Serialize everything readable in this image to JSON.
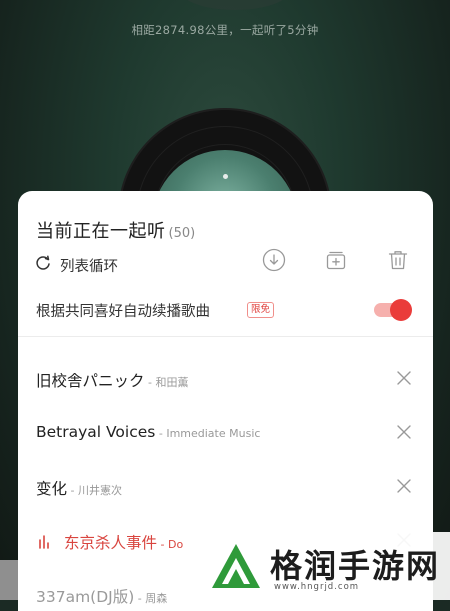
{
  "background": {
    "distance_text": "相距2874.98公里，一起听了5分钟"
  },
  "panel": {
    "title": "当前正在一起听",
    "count": "(50)",
    "play_mode_label": "列表循环",
    "actions": [
      {
        "icon": "download-icon"
      },
      {
        "icon": "add-to-playlist-icon"
      },
      {
        "icon": "trash-icon"
      }
    ],
    "autoplay": {
      "label": "根据共同喜好自动续播歌曲",
      "badge": "限免",
      "enabled": true
    },
    "songs": [
      {
        "title": "旧校舎パニック",
        "artist": " - 和田薫",
        "state": "normal"
      },
      {
        "title": "Betrayal Voices",
        "artist": " - Immediate Music",
        "state": "normal"
      },
      {
        "title": "变化",
        "artist": " - 川井憲次",
        "state": "normal"
      },
      {
        "title": "东京杀人事件",
        "artist": " - Do",
        "state": "playing"
      },
      {
        "title": "337am(DJ版)",
        "artist": " - 周森",
        "state": "dim"
      }
    ]
  },
  "colors": {
    "accent": "#ea3c3a",
    "card": "#ffffff",
    "background": "#1f3a2f"
  },
  "watermark": {
    "text": "格润手游网",
    "url": "www.hngrjd.com"
  }
}
